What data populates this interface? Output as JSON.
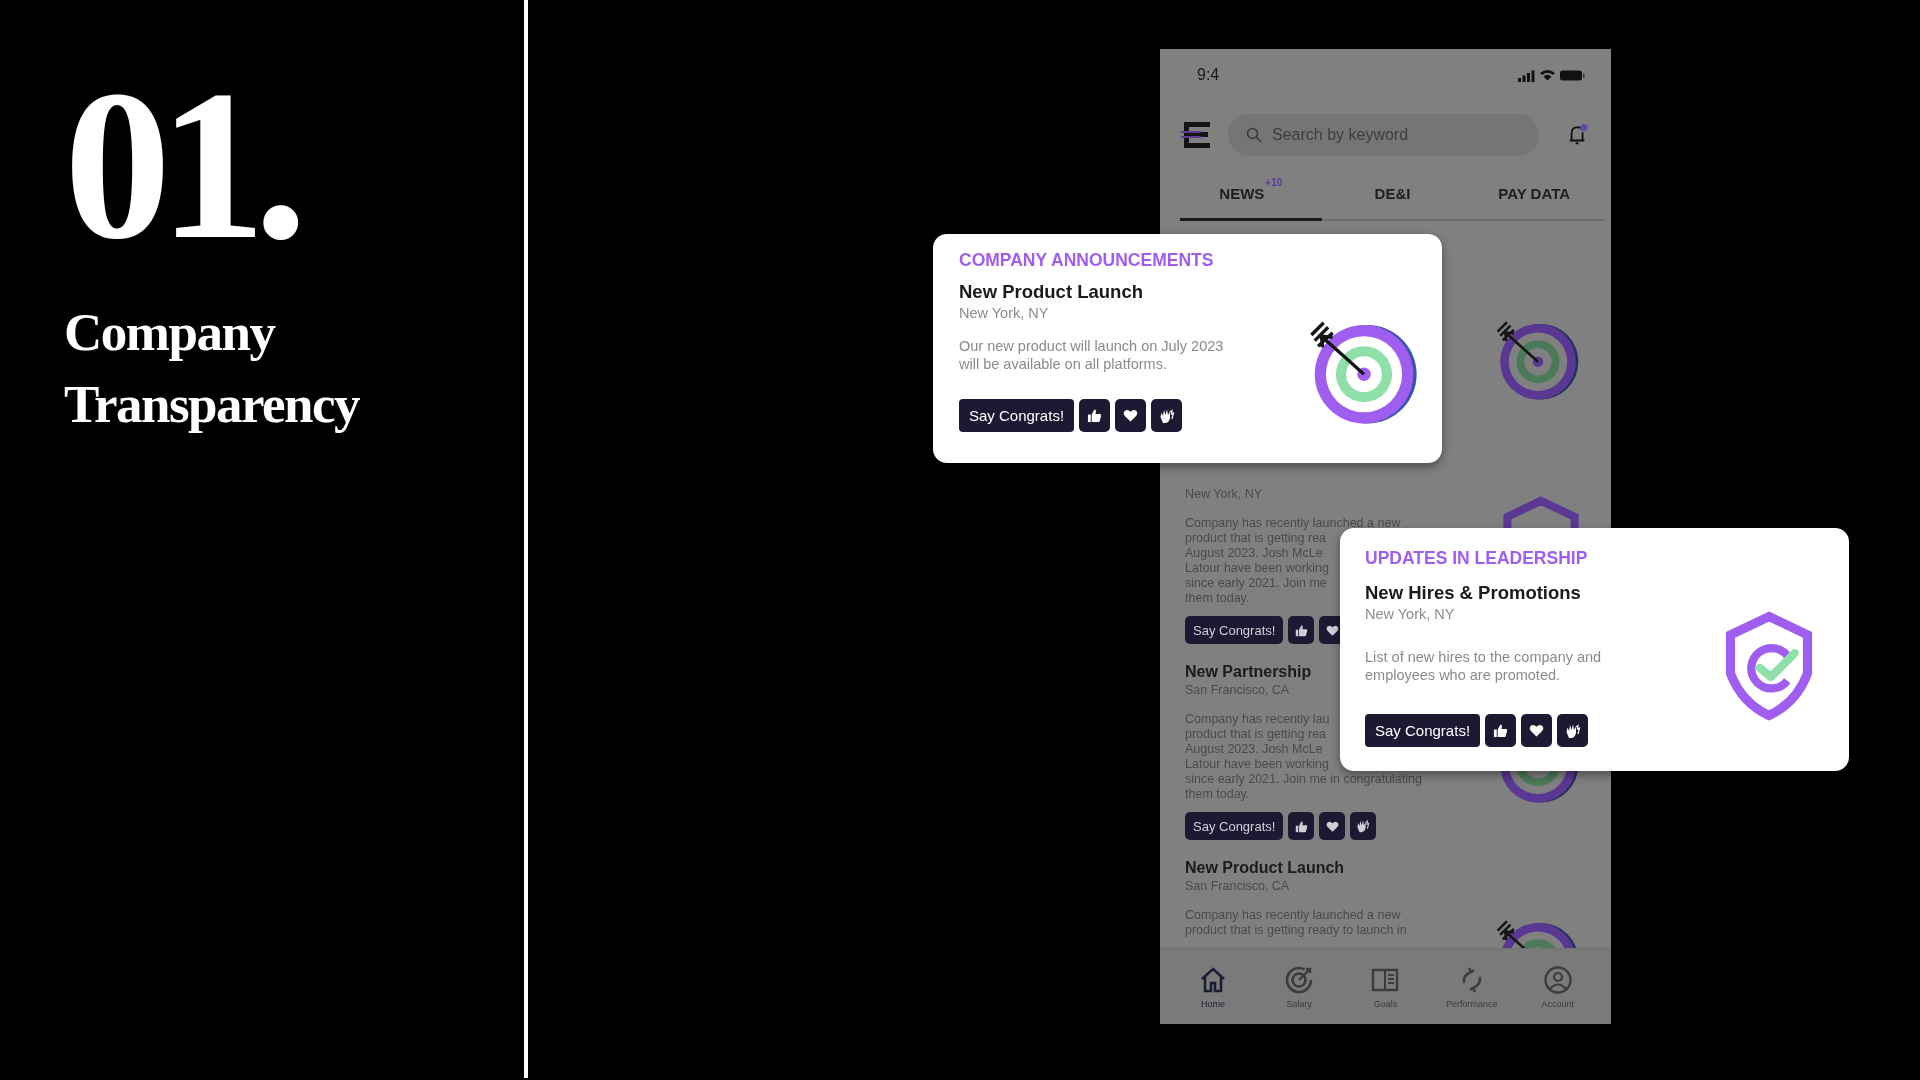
{
  "slide": {
    "number": "01.",
    "title_lines": [
      "Company",
      "Transparency"
    ]
  },
  "phone": {
    "status_bar": {
      "time": "9:4"
    },
    "search": {
      "placeholder": "Search by keyword"
    },
    "bell": {
      "unread": true
    },
    "tabs": [
      {
        "label": "NEWS",
        "badge": "+10",
        "selected": true
      },
      {
        "label": "DE&I",
        "selected": false
      },
      {
        "label": "PAY DATA",
        "selected": false
      }
    ],
    "feed": [
      {
        "kind": "target"
      },
      {
        "location": "New York, NY",
        "body_lines": [
          "Company has recently launched a new",
          "product that is getting rea",
          "August 2023. Josh McLe",
          "Latour have been working",
          "since early 2021. Join me",
          "them today."
        ],
        "button": "Say Congrats!",
        "reactions": [
          {
            "kind": "like"
          },
          {
            "kind": "love"
          }
        ],
        "kind": "shield"
      },
      {
        "title": "New Partnership",
        "location": "San Francisco, CA",
        "body_lines": [
          "Company has recently lau",
          "product that is getting rea",
          "August 2023. Josh McLe",
          "Latour have been working",
          "since early 2021. Join me in congratulating",
          "them today."
        ],
        "button": "Say Congrats!",
        "reactions": [
          {
            "kind": "like"
          },
          {
            "kind": "love"
          },
          {
            "kind": "clap"
          }
        ],
        "kind": "target"
      },
      {
        "title": "New Product Launch",
        "location": "San Francisco, CA",
        "body_lines": [
          "Company has recently launched a new",
          "product that is getting ready to launch in"
        ],
        "kind": "target"
      }
    ],
    "nav": [
      {
        "label": "Home",
        "kind": "home",
        "selected": true
      },
      {
        "label": "Salary",
        "kind": "dart",
        "selected": false
      },
      {
        "label": "Goals",
        "kind": "book",
        "selected": false
      },
      {
        "label": "Performance",
        "kind": "cycle",
        "selected": false
      },
      {
        "label": "Account",
        "kind": "person",
        "selected": false
      }
    ]
  },
  "cards": [
    {
      "category": "COMPANY ANNOUNCEMENTS",
      "title": "New Product Launch",
      "location": "New York, NY",
      "body": "Our new product will launch on July 2023 will be available on all platforms.",
      "button": "Say Congrats!",
      "kind": "target"
    },
    {
      "category": "UPDATES IN LEADERSHIP",
      "title": "New Hires & Promotions",
      "location": "New York, NY",
      "body": "List of new hires to the company and employees who are promoted.",
      "button": "Say Congrats!",
      "kind": "shield"
    }
  ]
}
